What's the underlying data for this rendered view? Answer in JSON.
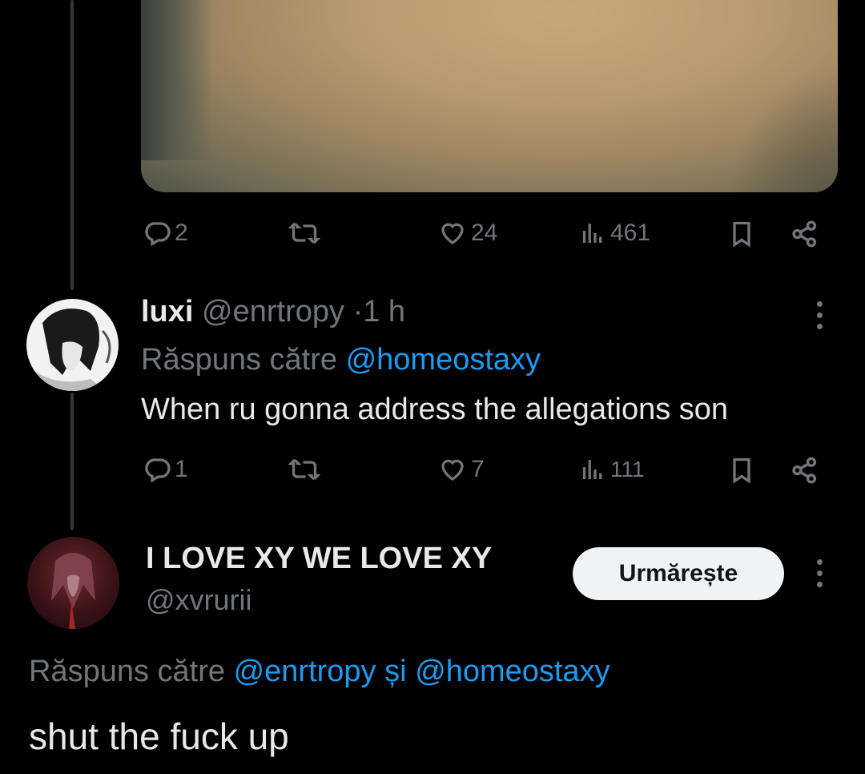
{
  "tweet1": {
    "actions": {
      "replies": "2",
      "retweets": "",
      "likes": "24",
      "views": "461"
    }
  },
  "tweet2": {
    "display_name": "luxi",
    "handle": "@enrtropy",
    "separator": "·",
    "time": "1 h",
    "reply_prefix": "Răspuns către",
    "reply_to": "@homeostaxy",
    "text": "When ru gonna address the allegations son",
    "actions": {
      "replies": "1",
      "retweets": "",
      "likes": "7",
      "views": "111"
    }
  },
  "tweet3": {
    "display_name": "I LOVE XY WE LOVE XY",
    "handle": "@xvrurii",
    "follow_label": "Urmărește",
    "reply_prefix": "Răspuns către",
    "reply_to_1": "@enrtropy",
    "reply_conj": "și",
    "reply_to_2": "@homeostaxy",
    "text": "shut the fuck up"
  },
  "colors": {
    "background": "#000000",
    "text": "#e7e9ea",
    "muted": "#71767b",
    "link": "#1d9bf0",
    "button_bg": "#eff3f4"
  },
  "icons": [
    "reply-icon",
    "retweet-icon",
    "like-icon",
    "views-icon",
    "bookmark-icon",
    "share-icon",
    "more-icon"
  ]
}
